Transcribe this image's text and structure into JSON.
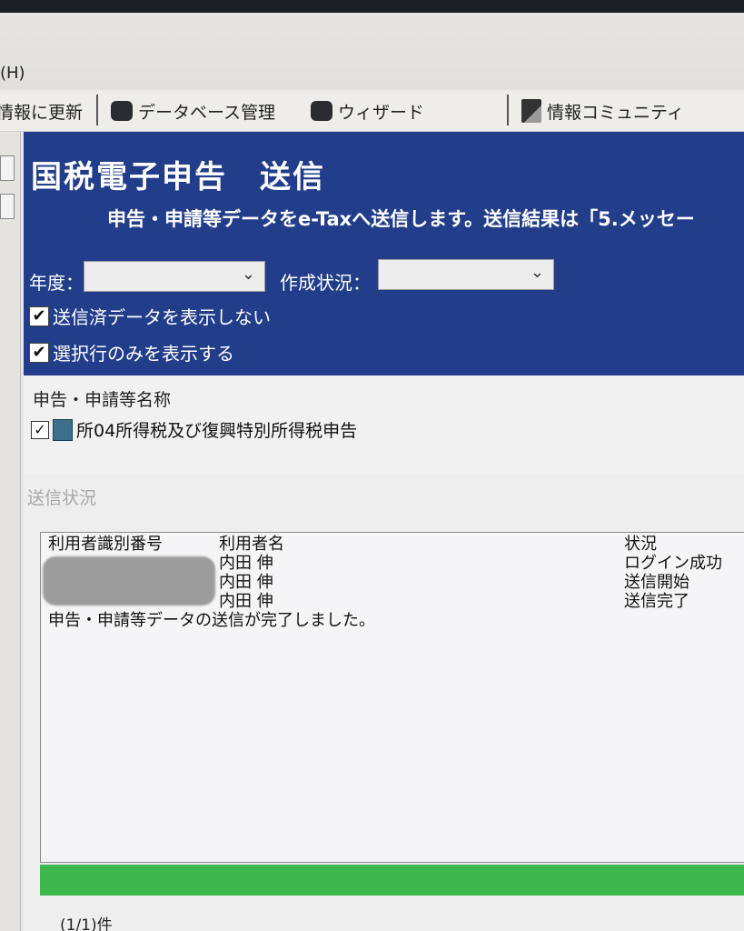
{
  "menubar": {
    "help_label": "(H)"
  },
  "toolbar": {
    "items": [
      {
        "label": "情報に更新"
      },
      {
        "label": "データベース管理"
      },
      {
        "label": "ウィザード"
      },
      {
        "label": "情報コミュニティ"
      }
    ]
  },
  "header": {
    "title": "国税電子申告　送信",
    "subtitle": "申告・申請等データをe-Taxへ送信します。送信結果は「5.メッセー",
    "year_label": "年度：",
    "year_value": "",
    "status_label": "作成状況：",
    "status_value": "",
    "check_hide_sent": "送信済データを表示しない",
    "check_show_selected": "選択行のみを表示する",
    "colors": {
      "header_bg": "#223d8a",
      "progress": "#3db64b"
    }
  },
  "list": {
    "header": "申告・申請等名称",
    "rows": [
      {
        "checked": true,
        "name": "所04所得税及び復興特別所得税申告"
      }
    ]
  },
  "status": {
    "label": "送信状況",
    "columns": {
      "id": "利用者識別番号",
      "name": "利用者名",
      "state": "状況"
    },
    "rows": [
      {
        "name": "内田 伸",
        "state": "ログイン成功"
      },
      {
        "name": "内田 伸",
        "state": "送信開始"
      },
      {
        "name": "内田 伸",
        "state": "送信完了"
      }
    ],
    "message": "申告・申請等データの送信が完了しました。",
    "progress_percent": 100
  },
  "footer": {
    "count": "(1/1)件"
  }
}
